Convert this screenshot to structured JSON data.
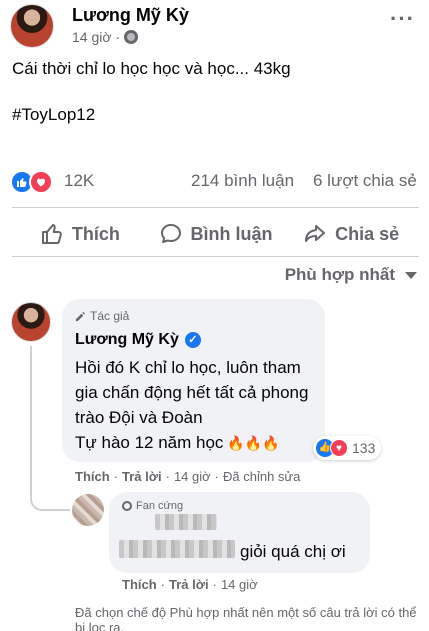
{
  "post": {
    "author": "Lương Mỹ Kỳ",
    "time": "14 giờ",
    "separator": "·",
    "more": "···",
    "text": "Cái thời chỉ lo học học và học... 43kg",
    "hashtag": "#ToyLop12",
    "reaction_count": "12K",
    "comment_count": "214 bình luận",
    "share_count": "6 lượt chia sẻ"
  },
  "actions": {
    "like": "Thích",
    "comment": "Bình luận",
    "share": "Chia sẻ"
  },
  "sort": {
    "label": "Phù hợp nhất"
  },
  "comment1": {
    "badge": "Tác giả",
    "author": "Lương Mỹ Kỳ",
    "text": "Hồi đó K chỉ lo học, luôn tham gia chấn động hết tất cả phong trào Đội và Đoàn",
    "text2": "Tự hào 12 năm học",
    "fire": "🔥🔥🔥",
    "reactions": "133",
    "like": "Thích",
    "dot": "·",
    "reply": "Trả lời",
    "time": "14 giờ",
    "edited": "Đã chỉnh sửa"
  },
  "comment2": {
    "badge": "Fan cứng",
    "text": "giỏi quá chị ơi",
    "like": "Thích",
    "dot": "·",
    "reply": "Trả lời",
    "time": "14 giờ"
  },
  "notice": "Đã chọn chế độ Phù hợp nhất nên một số câu trả lời có thể bị lọc ra.",
  "colors": {
    "like_blue": "#1877f2",
    "love_red": "#f33e58",
    "secondary_text": "#65676b",
    "bubble_bg": "#f0f2f5"
  }
}
